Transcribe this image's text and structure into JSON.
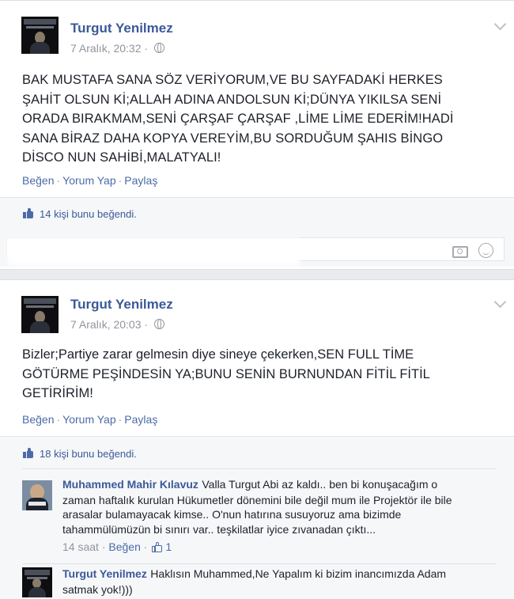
{
  "post1": {
    "author": "Turgut Yenilmez",
    "timestamp": "7 Aralık, 20:32",
    "text_lines": [
      "BAK MUSTAFA SANA SÖZ VERİYORUM,VE BU SAYFADAKİ HERKES",
      "ŞAHİT OLSUN Kİ;ALLAH ADINA ANDOLSUN Kİ;DÜNYA YIKILSA SENİ",
      "ORADA BIRAKMAM,SENİ ÇARŞAF ÇARŞAF ,LİME LİME EDERİM!HADİ",
      "SANA BİRAZ DAHA KOPYA VEREYİM,BU SORDUĞUM ŞAHIS BİNGO",
      "DİSCO NUN SAHİBİ,MALATYALI!"
    ],
    "actions": {
      "like": "Beğen",
      "comment": "Yorum Yap",
      "share": "Paylaş",
      "sep": "·"
    },
    "likes_text": "14 kişi bunu beğendi."
  },
  "post2": {
    "author": "Turgut Yenilmez",
    "timestamp": "7 Aralık, 20:03",
    "text_lines": [
      "Bizler;Partiye zarar gelmesin diye sineye çekerken,SEN FULL TİME",
      "GÖTÜRME PEŞİNDESİN YA;BUNU SENİN BURNUNDAN FİTİL FİTİL",
      "GETİRİRİM!"
    ],
    "actions": {
      "like": "Beğen",
      "comment": "Yorum Yap",
      "share": "Paylaş",
      "sep": "·"
    },
    "likes_text": "18 kişi bunu beğendi.",
    "comments": [
      {
        "author": "Muhammed Mahir Kılavuz",
        "text_lines": [
          "Valla Turgut Abi az kaldı.. ben bi konuşacağım o",
          "zaman haftalık kurulan Hükumetler dönemini bile değil mum ile Projektör ile bile",
          "arasalar bulamayacak kimse.. O'nun hatırına susuyoruz ama bizimde",
          "tahammülümüzün bi sınırı var.. teşkilatlar iyice zıvanadan çıktı..."
        ],
        "time": "14 saat",
        "like": "Beğen",
        "like_count": "1"
      },
      {
        "author": "Turgut Yenilmez",
        "text_lines": [
          "Haklısın Muhammed,Ne Yapalım ki bizim inancımızda Adam",
          "satmak yok!)))"
        ]
      }
    ]
  },
  "icons": [
    "chevron-down-icon",
    "globe-icon",
    "like-thumb-icon",
    "camera-icon",
    "emoji-icon"
  ],
  "colors": {
    "link": "#3b5998",
    "meta": "#90949c",
    "background": "#e9ebee"
  }
}
